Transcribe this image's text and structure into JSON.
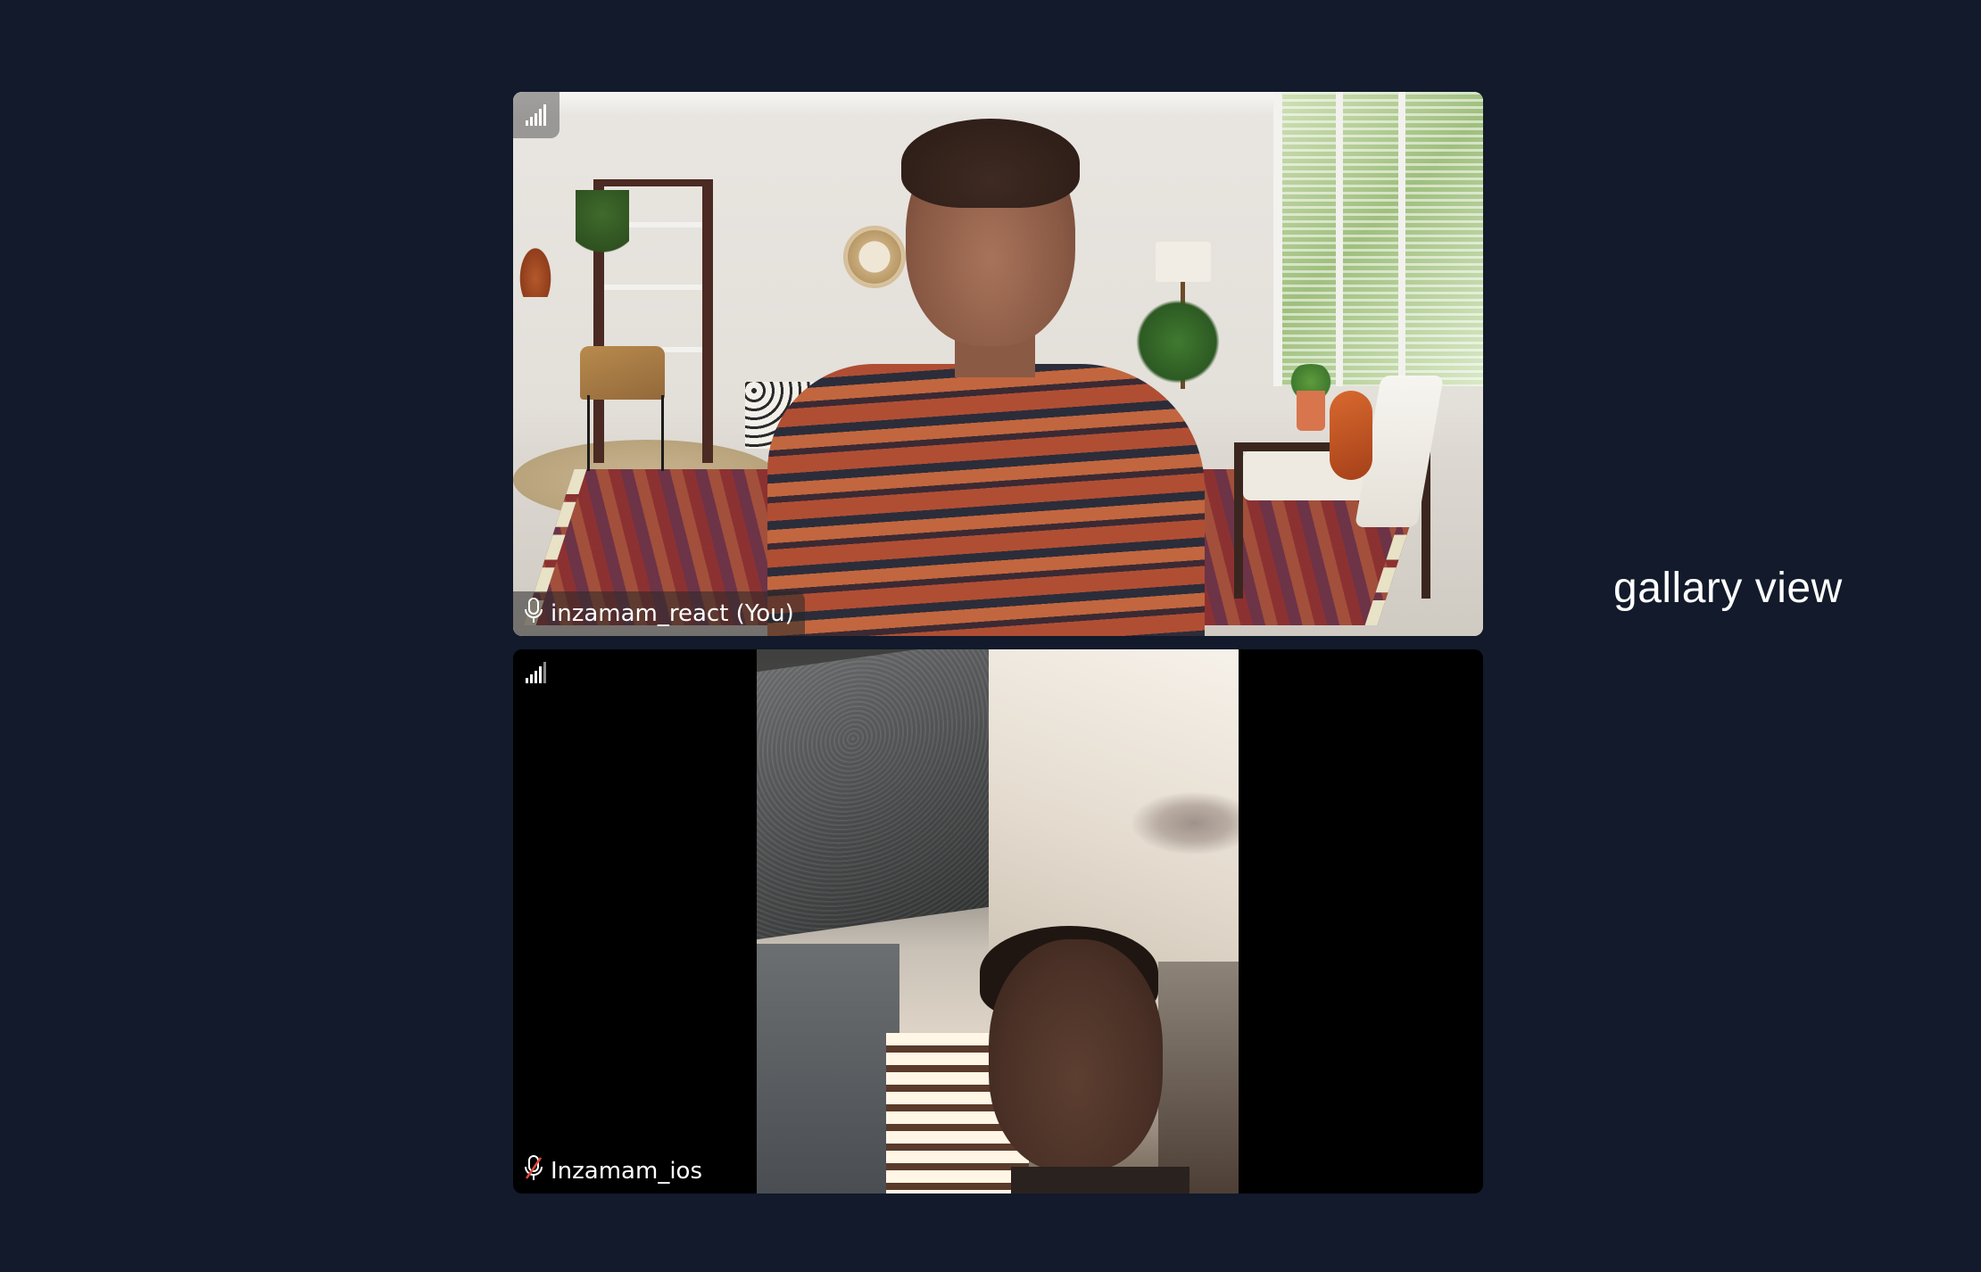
{
  "meeting": {
    "layout_label": "gallary view"
  },
  "participants": [
    {
      "name": "inzamam_react (You)",
      "is_local": true,
      "mic": "on",
      "signal_icon": "signal-strength-icon",
      "video": "virtual-background-room"
    },
    {
      "name": "Inzamam_ios",
      "is_local": false,
      "mic": "muted",
      "signal_icon": "signal-strength-icon",
      "video": "portrait-camera-feed"
    }
  ],
  "colors": {
    "background": "#121a2b",
    "tile_background": "#000000",
    "label_text": "#ffffff",
    "muted_mic": "#e0453a"
  }
}
